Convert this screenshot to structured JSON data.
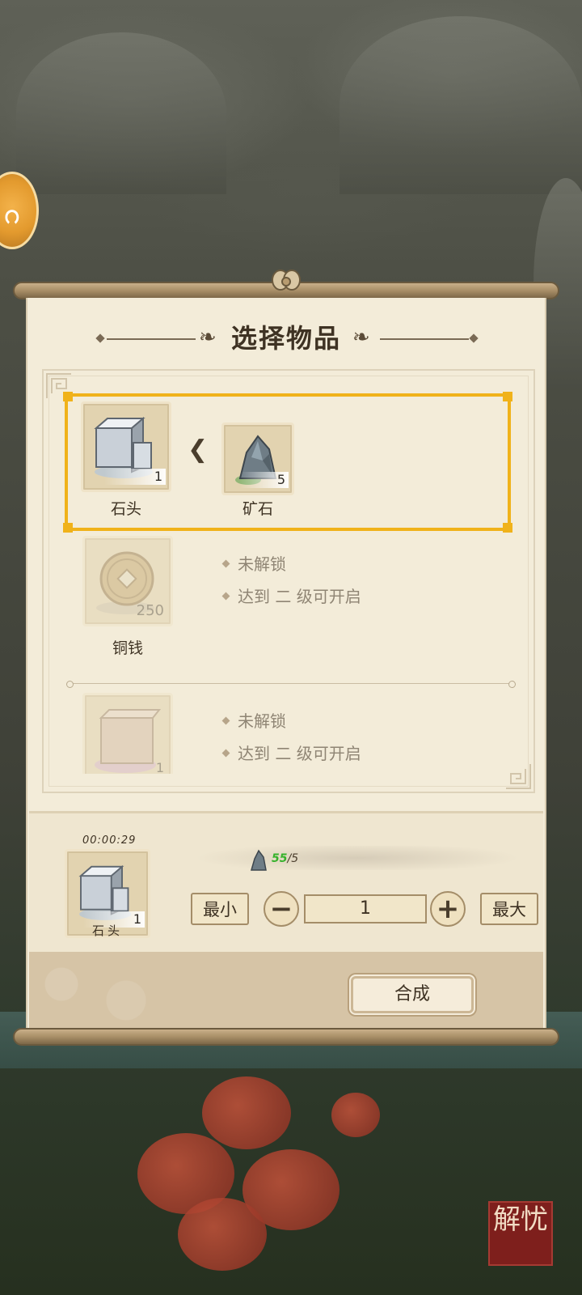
{
  "dialog": {
    "title": "选择物品"
  },
  "recipes": [
    {
      "state": "selected",
      "product": {
        "name": "石头",
        "count": "1",
        "icon": "stone-block-icon"
      },
      "material": {
        "name": "矿石",
        "count": "5",
        "icon": "ore-icon"
      }
    },
    {
      "state": "locked",
      "product": {
        "name": "铜钱",
        "count": "250",
        "icon": "copper-coin-icon"
      },
      "lock_lines": [
        "未解锁",
        "达到 二 级可开启"
      ]
    },
    {
      "state": "locked",
      "product": {
        "name": "",
        "count": "1",
        "icon": "brick-icon"
      },
      "lock_lines": [
        "未解锁",
        "达到 二 级可开启"
      ]
    }
  ],
  "craft": {
    "timer": "00:00:29",
    "item_name": "石头",
    "item_count": "1",
    "material_have": "55",
    "material_need": "/5",
    "min_label": "最小",
    "max_label": "最大",
    "quantity": "1",
    "compose_label": "合成"
  },
  "seal_text": "解忧",
  "colors": {
    "highlight": "#f0b21a",
    "parchment": "#f3ecd9",
    "ink": "#3e3223",
    "material_ok": "#35b22b"
  }
}
